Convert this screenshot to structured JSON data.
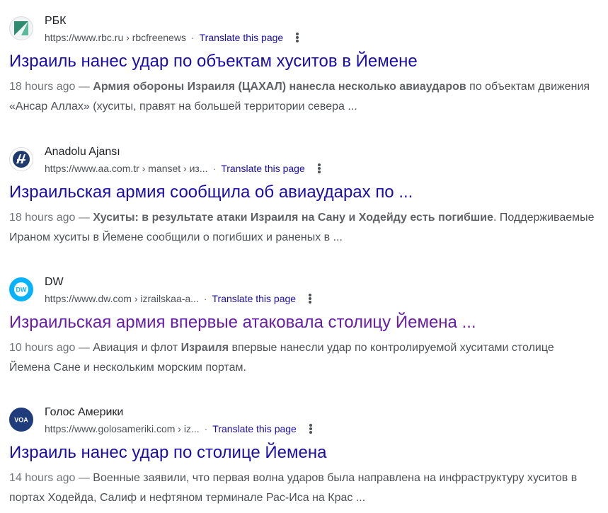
{
  "results": [
    {
      "site_name": "РБК",
      "url": "https://www.rbc.ru › rbcfreenews",
      "translate": "Translate this page",
      "title": "Израиль нанес удар по объектам хуситов в Йемене",
      "date": "18 hours ago —",
      "snippet": [
        {
          "t": " "
        },
        {
          "t": "Армия обороны Израиля (ЦАХАЛ) нанесла несколько авиаударов",
          "b": true
        },
        {
          "t": " по объектам движения «Ансар Аллах» (хуситы, правят на большей территории севера ..."
        }
      ],
      "favicon_icon": "rbc-logo-icon",
      "visited": false
    },
    {
      "site_name": "Anadolu Ajansı",
      "url": "https://www.aa.com.tr › manset › из...",
      "translate": "Translate this page",
      "title": "Израильская армия сообщила об авиаударах по ...",
      "date": "18 hours ago —",
      "snippet": [
        {
          "t": " "
        },
        {
          "t": "Хуситы: в результате атаки Израиля на Сану и Ходейду есть погибшие",
          "b": true
        },
        {
          "t": ". Поддерживаемые Ираном хуситы в Йемене сообщили о погибших и раненых в ..."
        }
      ],
      "favicon_icon": "anadolu-logo-icon",
      "visited": false
    },
    {
      "site_name": "DW",
      "url": "https://www.dw.com › izrailskaa-a...",
      "translate": "Translate this page",
      "title": "Израильская армия впервые атаковала столицу Йемена ...",
      "date": "10 hours ago —",
      "snippet": [
        {
          "t": " Авиация и флот "
        },
        {
          "t": "Израиля",
          "b": true
        },
        {
          "t": " впервые нанесли удар по контролируемой хуситами столице Йемена Сане и нескольким морским портам."
        }
      ],
      "favicon_icon": "dw-logo-icon",
      "visited": true
    },
    {
      "site_name": "Голос Америки",
      "url": "https://www.golosameriki.com › iz...",
      "translate": "Translate this page",
      "title": "Израиль нанес удар по столице Йемена",
      "date": "14 hours ago —",
      "snippet": [
        {
          "t": " Военные заявили, что первая волна ударов была направлена на инфраструктуру хуситов в портах Ходейда, Салиф и нефтяном терминале Рас-Иса на Крас ..."
        }
      ],
      "favicon_icon": "voa-logo-icon",
      "visited": false
    }
  ],
  "favicons": {
    "dw_text": "DW",
    "voa_text": "VOA"
  },
  "colors": {
    "link": "#1a0dab",
    "visited": "#681da8",
    "snippet": "#4d5156"
  }
}
